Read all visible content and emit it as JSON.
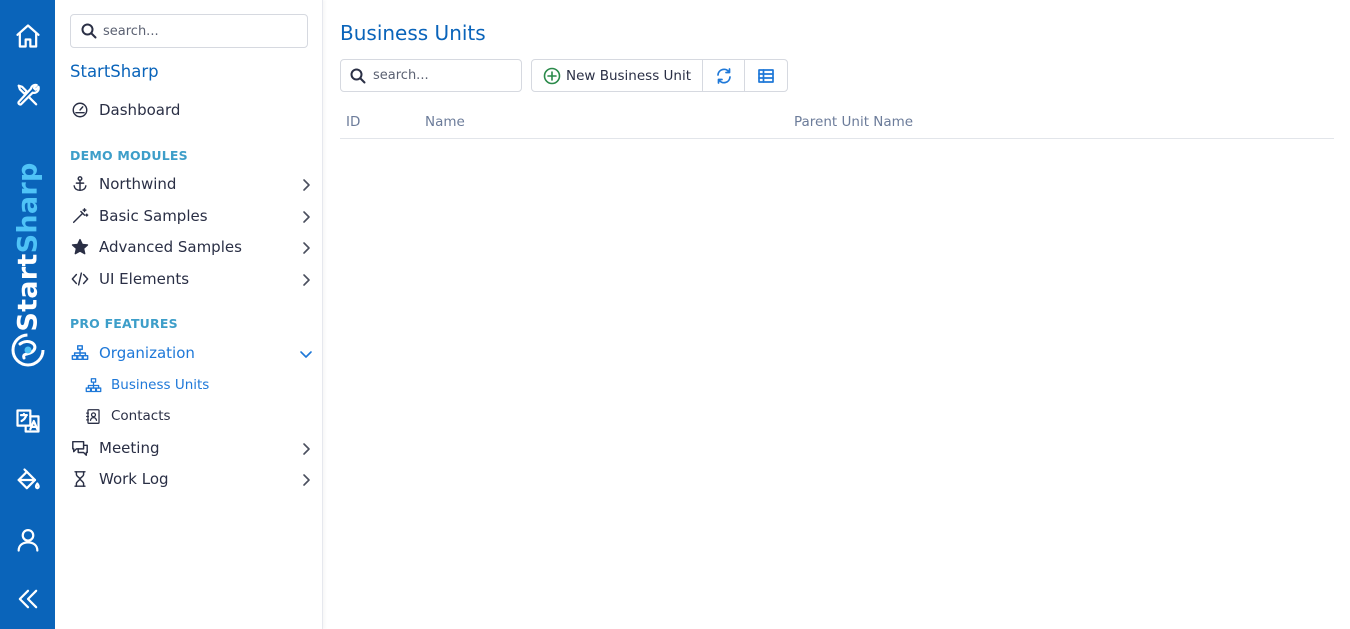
{
  "rail": {
    "brand_start": "Start",
    "brand_sharp": "Sharp",
    "buttons": [
      "home-icon",
      "tools-icon",
      "translate-icon",
      "theme-icon",
      "user-icon",
      "collapse-icon"
    ]
  },
  "sidebar": {
    "search_placeholder": "search...",
    "title": "StartSharp",
    "dashboard": "Dashboard",
    "demo_header": "DEMO MODULES",
    "demo_items": [
      "Northwind",
      "Basic Samples",
      "Advanced Samples",
      "UI Elements"
    ],
    "pro_header": "PRO FEATURES",
    "organization": "Organization",
    "org_sub": [
      "Business Units",
      "Contacts"
    ],
    "meeting": "Meeting",
    "worklog": "Work Log"
  },
  "main": {
    "title": "Business Units",
    "search_placeholder": "search...",
    "new_button": "New Business Unit",
    "columns": [
      "ID",
      "Name",
      "Parent Unit Name"
    ]
  },
  "colors": {
    "rail": "#0a64ba",
    "accent": "#1e78d8",
    "section": "#3d9ec9"
  }
}
